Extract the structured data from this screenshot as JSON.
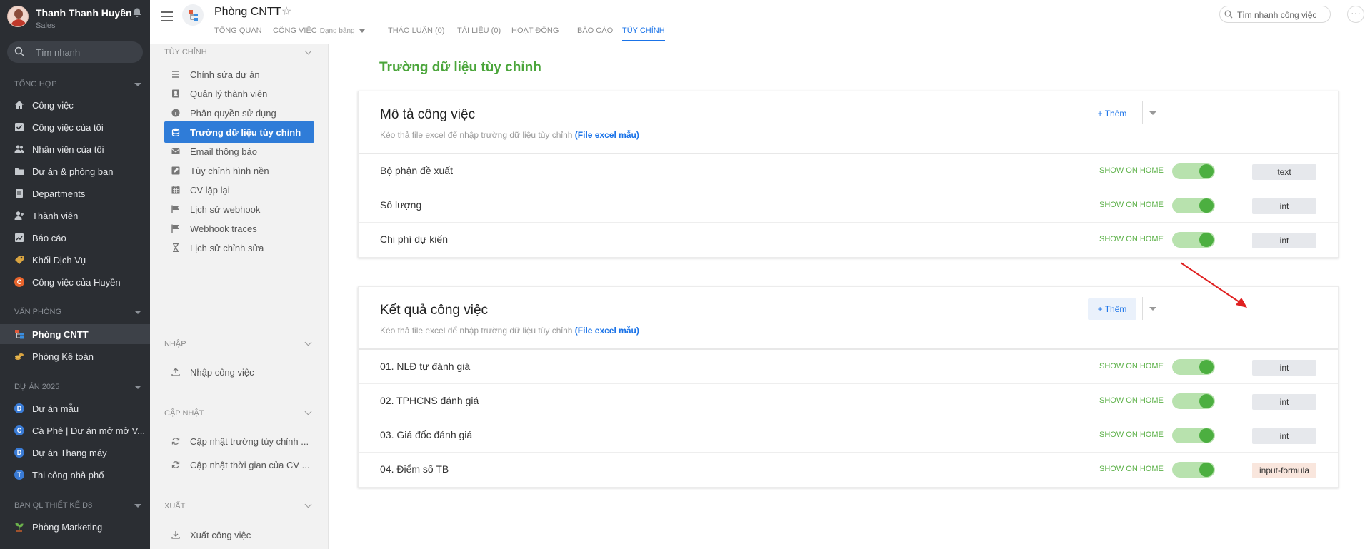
{
  "user": {
    "name": "Thanh Thanh Huyền",
    "role": "Sales"
  },
  "nav": {
    "search_placeholder": "Tìm nhanh",
    "sections": {
      "tong_hop": "TỔNG HỢP",
      "van_phong": "VĂN PHÒNG",
      "du_an": "DỰ ÁN 2025",
      "ban_ql": "BAN QL THIẾT KẾ D8"
    },
    "items": {
      "cong_viec": "Công việc",
      "cong_viec_cua_toi": "Công việc của tôi",
      "nhan_vien": "Nhân viên của tôi",
      "du_an_phong_ban": "Dự án & phòng ban",
      "departments": "Departments",
      "thanh_vien": "Thành viên",
      "bao_cao": "Báo cáo",
      "khoi_dich_vu": "Khối Dịch Vụ",
      "cv_huyen": "Công việc của Huyền",
      "phong_cntt": "Phòng CNTT",
      "phong_ke_toan": "Phòng Kế toán",
      "du_an_mau": "Dự án mẫu",
      "ca_phe": "Cà Phê | Dự án mở mở V...",
      "thang_may": "Dự án Thang máy",
      "nha_pho": "Thi công nhà phố",
      "marketing": "Phòng Marketing"
    },
    "badges": {
      "cv_huyen": "C",
      "du_an_mau": "D",
      "ca_phe": "C",
      "thang_may": "D",
      "nha_pho": "T"
    }
  },
  "header": {
    "title": "Phòng CNTT",
    "tabs": {
      "tong_quan": "TỔNG QUAN",
      "cong_viec": "CÔNG VIỆC",
      "cong_viec_sub": "Dạng bảng",
      "thao_luan": "THẢO LUẬN (0)",
      "tai_lieu": "TÀI LIỆU (0)",
      "hoat_dong": "HOẠT ĐỘNG",
      "bao_cao": "BÁO CÁO",
      "tuy_chinh": "TÙY CHỈNH"
    },
    "search_placeholder": "Tìm nhanh công việc"
  },
  "settings": {
    "tuy_chinh": {
      "title": "TÙY CHỈNH",
      "items": {
        "chinh_sua": "Chỉnh sửa dự án",
        "quan_ly_tv": "Quản lý thành viên",
        "phan_quyen": "Phân quyền sử dụng",
        "truong_du_lieu": "Trường dữ liệu tùy chỉnh",
        "email": "Email thông báo",
        "hinh_nen": "Tùy chỉnh hình nền",
        "cv_lap_lai": "CV lặp lại",
        "webhook": "Lịch sử webhook",
        "webhook_traces": "Webhook traces",
        "lich_su": "Lịch sử chỉnh sửa"
      }
    },
    "nhap": {
      "title": "NHẬP",
      "items": {
        "nhap_cv": "Nhập công việc"
      }
    },
    "cap_nhat": {
      "title": "CẬP NHẬT",
      "items": {
        "truong": "Cập nhật trường tùy chỉnh ...",
        "thoi_gian": "Cập nhật thời gian của CV ..."
      }
    },
    "xuat": {
      "title": "XUẤT",
      "items": {
        "xuat_cv": "Xuất công việc"
      }
    }
  },
  "main": {
    "title": "Trường dữ liệu tùy chỉnh",
    "sub_prefix": "Kéo thả file excel để nhập trường dữ liệu tùy chỉnh",
    "sub_link": "(File excel mẫu)",
    "add_label": "+ Thêm",
    "show_on_home": "SHOW ON HOME",
    "cards": [
      {
        "title": "Mô tả công việc",
        "rows": [
          {
            "name": "Bộ phận đề xuất",
            "type": "text",
            "show": true
          },
          {
            "name": "Số lượng",
            "type": "int",
            "show": true
          },
          {
            "name": "Chi phí dự kiến",
            "type": "int",
            "show": true
          }
        ]
      },
      {
        "title": "Kết quả công việc",
        "rows": [
          {
            "name": "01. NLĐ tự đánh giá",
            "type": "int",
            "show": true
          },
          {
            "name": "02. TPHCNS đánh giá",
            "type": "int",
            "show": true
          },
          {
            "name": "03. Giá đốc đánh giá",
            "type": "int",
            "show": true
          },
          {
            "name": "04. Điểm số TB",
            "type": "input-formula",
            "show": true
          }
        ]
      }
    ]
  },
  "colors": {
    "accent": "#1a73e8",
    "green": "#4aa53a",
    "nav_bg": "#2b2e33",
    "arrow": "#e02020"
  }
}
